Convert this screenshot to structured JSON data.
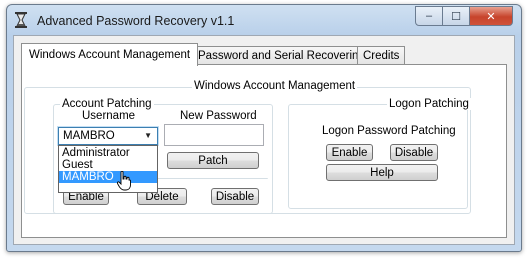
{
  "window": {
    "title": "Advanced Password Recovery v1.1",
    "minimize": "–",
    "maximize": "☐",
    "close": "✕"
  },
  "tabs": [
    {
      "label": "Windows Account Management",
      "active": true
    },
    {
      "label": "Password and Serial Recovering",
      "active": false
    },
    {
      "label": "Credits",
      "active": false
    }
  ],
  "main": {
    "group_title": "Windows Account Management",
    "account_patching": {
      "title": "Account Patching",
      "username_label": "Username",
      "new_password_label": "New Password",
      "username_value": "MAMBRO",
      "new_password_value": "",
      "dropdown_options": [
        "Administrator",
        "Guest",
        "MAMBRO"
      ],
      "dropdown_selected": "MAMBRO",
      "patch_button": "Patch",
      "enable_button": "Enable",
      "delete_button": "Delete",
      "disable_button": "Disable"
    },
    "logon_patching": {
      "title": "Logon Patching",
      "subtitle": "Logon Password Patching",
      "enable_button": "Enable",
      "disable_button": "Disable",
      "help_button": "Help"
    }
  },
  "colors": {
    "selection": "#3399ff",
    "close_button": "#c7442c"
  }
}
